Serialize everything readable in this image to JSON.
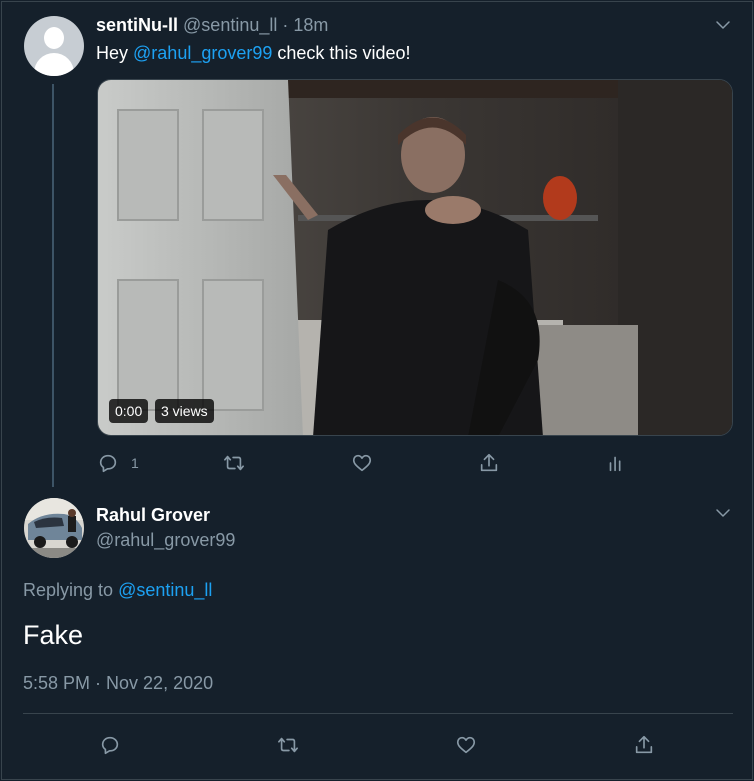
{
  "tweet1": {
    "display_name": "sentiNu-ll",
    "handle": "@sentinu_ll",
    "separator": "·",
    "time_ago": "18m",
    "text_prefix": "Hey",
    "mention": "@rahul_grover99",
    "text_suffix": "check this video!",
    "video": {
      "time": "0:00",
      "views": "3 views"
    },
    "actions": {
      "reply_icon": "reply-icon",
      "reply_count": "1",
      "retweet_icon": "retweet-icon",
      "like_icon": "heart-icon",
      "share_icon": "share-icon",
      "analytics_icon": "analytics-icon"
    }
  },
  "tweet2": {
    "display_name": "Rahul Grover",
    "handle": "@rahul_grover99",
    "replying_label": "Replying to",
    "replying_to": "@sentinu_ll",
    "text": "Fake",
    "timestamp": "5:58 PM · Nov 22, 2020",
    "actions": {
      "reply_icon": "reply-icon",
      "retweet_icon": "retweet-icon",
      "like_icon": "heart-icon",
      "share_icon": "share-icon"
    }
  },
  "colors": {
    "background": "#15202b",
    "text": "#ffffff",
    "muted": "#8899a6",
    "link": "#1da1f2",
    "border": "#38444d"
  }
}
